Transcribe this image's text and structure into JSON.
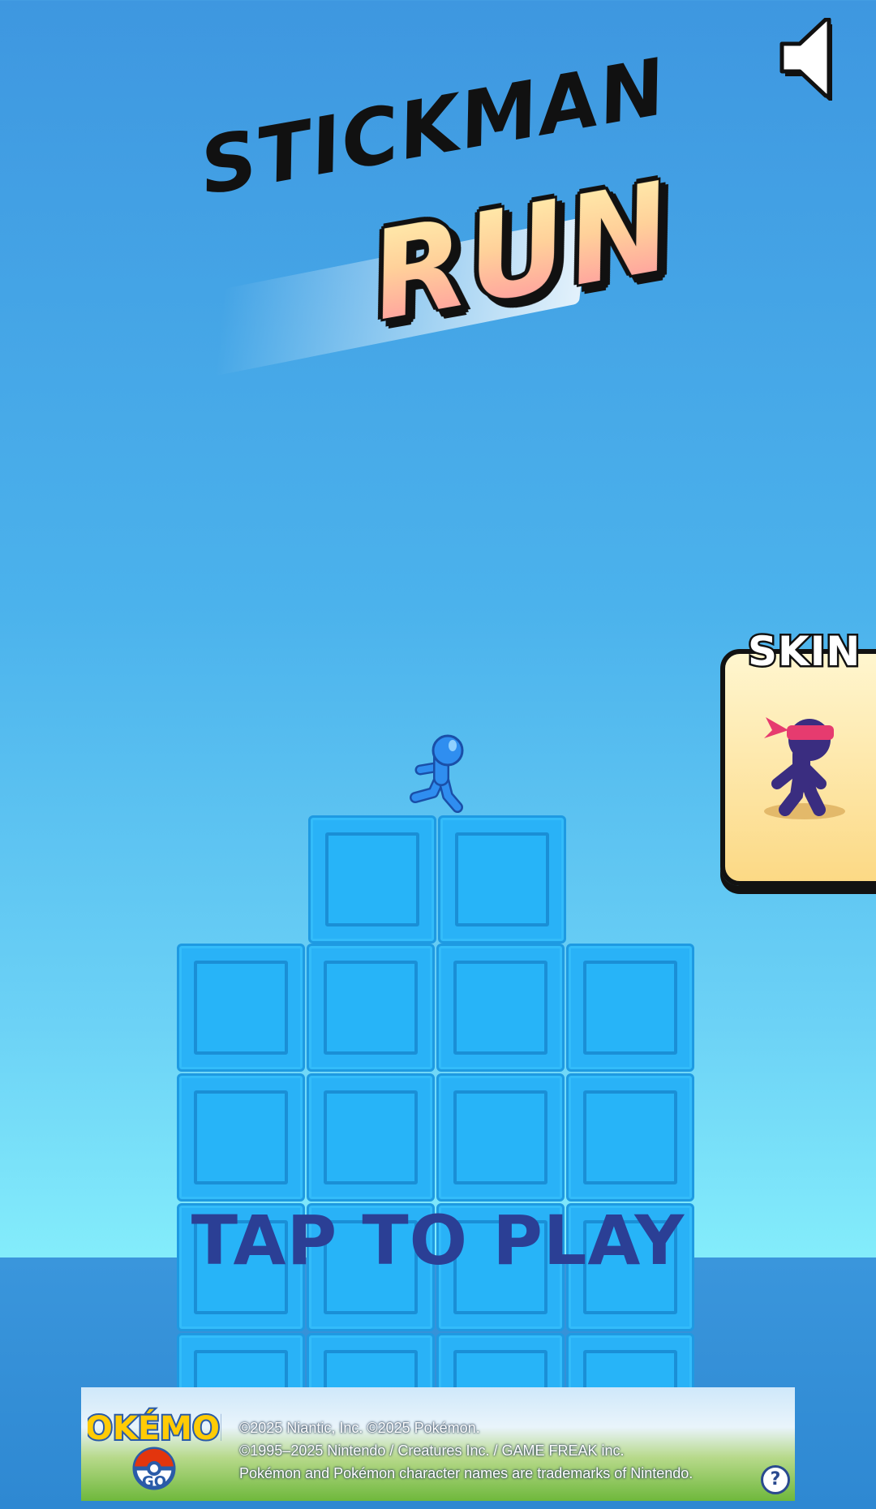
{
  "game": {
    "title_line1": "STICKMAN",
    "title_line2": "RUN",
    "tap_prompt": "TAP TO PLAY",
    "skin_label": "SKIN"
  },
  "icons": {
    "sound": "speaker-icon",
    "help": "question-icon",
    "player": "blue-stickman-runner",
    "skin_preview": "ninja-stickman-headband"
  },
  "ad": {
    "logo_word_top": "POKÉMON",
    "logo_word_bottom": "GO",
    "lines": [
      "©2025 Niantic, Inc. ©2025 Pokémon.",
      "©1995–2025 Nintendo / Creatures Inc. / GAME FREAK inc.",
      "Pokémon and Pokémon character names are trademarks of Nintendo."
    ],
    "help_label": "?"
  },
  "colors": {
    "sky_top": "#3e97e0",
    "sky_bottom": "#83ecfb",
    "block": "#29b2f7",
    "tap_text": "#2b3f95",
    "skin_panel": "#fcd985"
  }
}
